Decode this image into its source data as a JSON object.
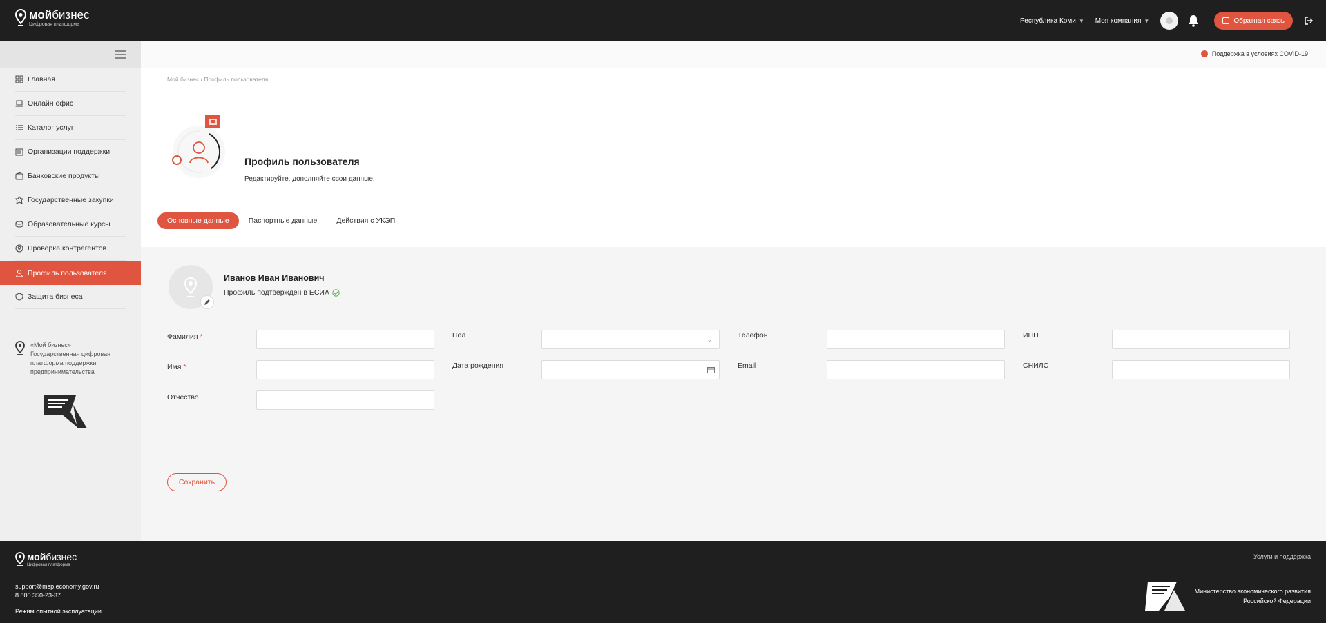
{
  "header": {
    "brand_bold": "мой",
    "brand_rest": "бизнес",
    "brand_sub": "Цифровая платформа",
    "region": "Республика Коми",
    "company": "Моя компания",
    "feedback_label": "Обратная связь",
    "accent": "#e0553f",
    "background": "#1f1f1f"
  },
  "sidebar": {
    "items": [
      {
        "label": "Главная",
        "icon": "grid-icon"
      },
      {
        "label": "Онлайн офис",
        "icon": "laptop-icon"
      },
      {
        "label": "Каталог услуг",
        "icon": "list-icon"
      },
      {
        "label": "Организации поддержки",
        "icon": "building-icon"
      },
      {
        "label": "Банковские продукты",
        "icon": "wallet-icon"
      },
      {
        "label": "Государственные закупки",
        "icon": "emblem-icon"
      },
      {
        "label": "Образовательные курсы",
        "icon": "books-icon"
      },
      {
        "label": "Проверка контрагентов",
        "icon": "search-person-icon"
      },
      {
        "label": "Профиль пользователя",
        "icon": "user-icon",
        "active": true
      },
      {
        "label": "Защита бизнеса",
        "icon": "shield-icon"
      }
    ],
    "info": "«Мой бизнес» Государственная цифровая платформа поддержки предпринимательства"
  },
  "topbar": {
    "covid": "Поддержка в условиях COVID-19"
  },
  "breadcrumb": {
    "home": "Мой бизнес",
    "separator": " / ",
    "current": "Профиль пользователя"
  },
  "page": {
    "title": "Профиль пользователя",
    "subtitle": "Редактируйте, дополняйте свои данные."
  },
  "tabs": [
    {
      "label": "Основные данные",
      "active": true
    },
    {
      "label": "Паспортные данные",
      "active": false
    },
    {
      "label": "Действия с УКЭП",
      "active": false
    }
  ],
  "user": {
    "name": "Иванов Иван Иванович",
    "status": "Профиль подтвержден в ЕСИА"
  },
  "form": {
    "surname_label": "Фамилия",
    "name_label": "Имя",
    "patronymic_label": "Отчество",
    "gender_label": "Пол",
    "birthdate_label": "Дата рождения",
    "phone_label": "Телефон",
    "email_label": "Email",
    "inn_label": "ИНН",
    "snils_label": "СНИЛС",
    "required_mark": "*",
    "surname_value": "",
    "name_value": "",
    "patronymic_value": "",
    "gender_value": "",
    "birthdate_value": "",
    "phone_value": "",
    "email_value": "",
    "inn_value": "",
    "snils_value": "",
    "save_label": "Сохранить"
  },
  "footer": {
    "brand_bold": "мой",
    "brand_rest": "бизнес",
    "brand_sub": "Цифровая платформа",
    "email": "support@msp.economy.gov.ru",
    "phone": "8 800 350-23-37",
    "mode": "Режим опытной эксплуатации",
    "services": "Услуги и поддержка",
    "ministry_line1": "Министерство экономического развития",
    "ministry_line2": "Российской Федерации"
  }
}
